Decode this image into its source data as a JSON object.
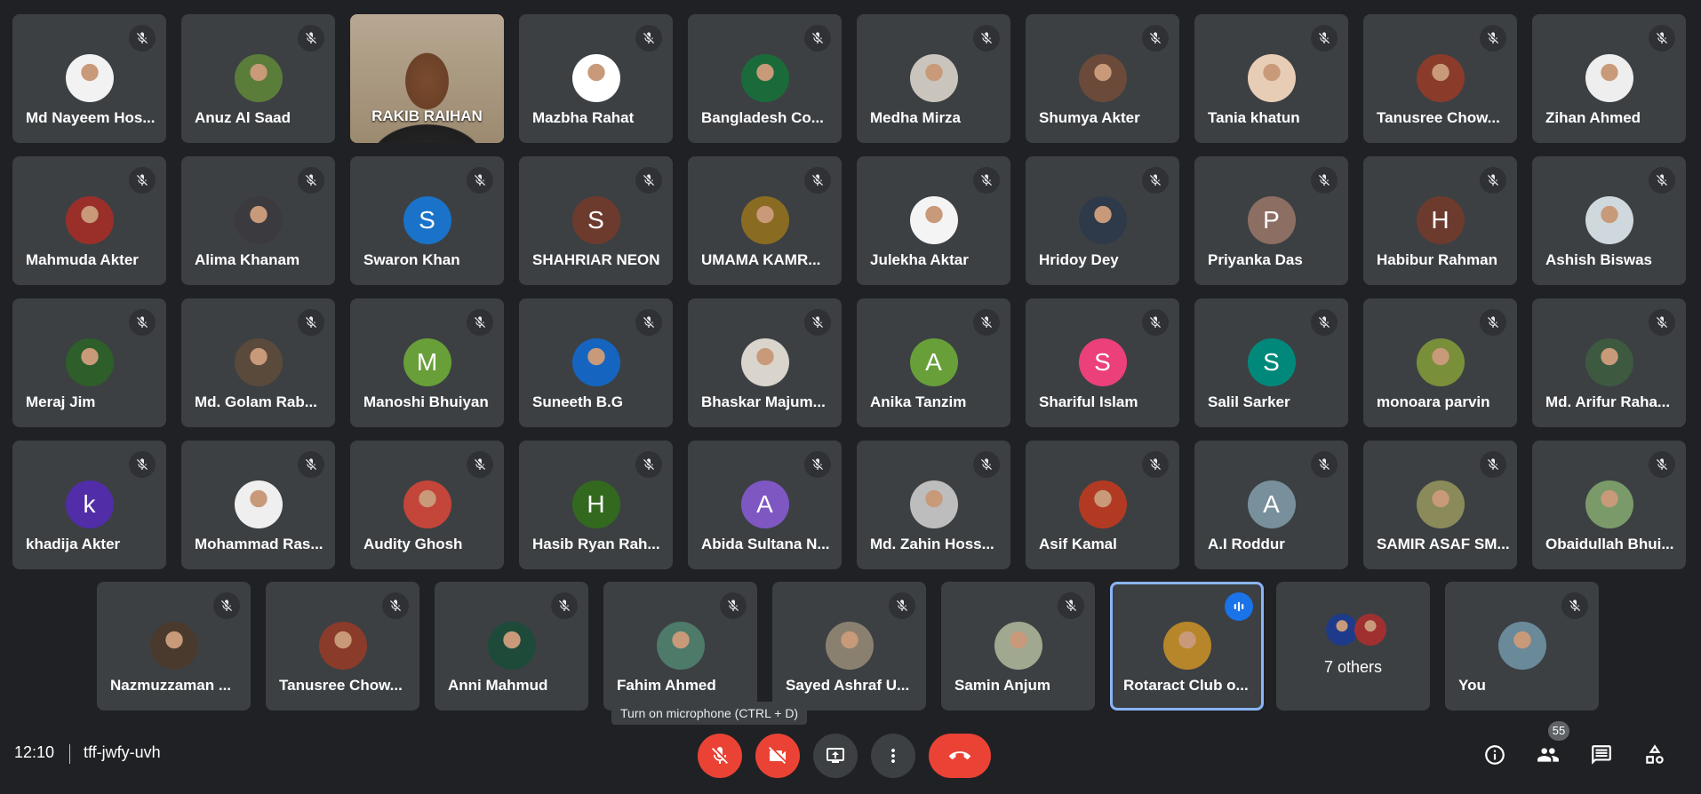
{
  "participants": [
    {
      "name": "Md Nayeem Hos...",
      "avatar": "photo",
      "color": "#f2f2f2"
    },
    {
      "name": "Anuz Al Saad",
      "avatar": "photo",
      "color": "#5b7d3a"
    },
    {
      "name": "RAKIB RAIHAN",
      "avatar": "video",
      "color": "#8a7358"
    },
    {
      "name": "Mazbha Rahat",
      "avatar": "photo",
      "color": "#ffffff"
    },
    {
      "name": "Bangladesh Co...",
      "avatar": "photo",
      "color": "#1b6b3a"
    },
    {
      "name": "Medha Mirza",
      "avatar": "photo",
      "color": "#c9c4bc"
    },
    {
      "name": "Shumya Akter",
      "avatar": "photo",
      "color": "#6b4a3a"
    },
    {
      "name": "Tania khatun",
      "avatar": "photo",
      "color": "#e8cdb6"
    },
    {
      "name": "Tanusree Chow...",
      "avatar": "photo",
      "color": "#8a3b2a"
    },
    {
      "name": "Zihan Ahmed",
      "avatar": "photo",
      "color": "#eeeeee"
    },
    {
      "name": "Mahmuda Akter",
      "avatar": "photo",
      "color": "#9a2f2a"
    },
    {
      "name": "Alima Khanam",
      "avatar": "photo",
      "color": "#3b3a3f"
    },
    {
      "name": "Swaron Khan",
      "avatar": "letter",
      "letter": "S",
      "color": "#1a73c8"
    },
    {
      "name": "SHAHRIAR NEON",
      "avatar": "letter",
      "letter": "S",
      "color": "#6d3b2e"
    },
    {
      "name": "UMAMA KAMR...",
      "avatar": "photo",
      "color": "#8a6b22"
    },
    {
      "name": "Julekha Aktar",
      "avatar": "photo",
      "color": "#f4f4f4"
    },
    {
      "name": "Hridoy Dey",
      "avatar": "photo",
      "color": "#2e3a4a"
    },
    {
      "name": "Priyanka Das",
      "avatar": "letter",
      "letter": "P",
      "color": "#8d6e63"
    },
    {
      "name": "Habibur Rahman",
      "avatar": "letter",
      "letter": "H",
      "color": "#6d3b2e"
    },
    {
      "name": "Ashish Biswas",
      "avatar": "photo",
      "color": "#cfd8dc"
    },
    {
      "name": "Meraj Jim",
      "avatar": "photo",
      "color": "#2e5e2a"
    },
    {
      "name": "Md. Golam Rab...",
      "avatar": "photo",
      "color": "#5a4a3c"
    },
    {
      "name": "Manoshi Bhuiyan",
      "avatar": "letter",
      "letter": "M",
      "color": "#689f38"
    },
    {
      "name": "Suneeth B.G",
      "avatar": "photo",
      "color": "#1565c0"
    },
    {
      "name": "Bhaskar Majum...",
      "avatar": "photo",
      "color": "#d9d4cc"
    },
    {
      "name": "Anika Tanzim",
      "avatar": "letter",
      "letter": "A",
      "color": "#689f38"
    },
    {
      "name": "Shariful Islam",
      "avatar": "letter",
      "letter": "S",
      "color": "#ec407a"
    },
    {
      "name": "Salil Sarker",
      "avatar": "letter",
      "letter": "S",
      "color": "#00897b"
    },
    {
      "name": "monoara parvin",
      "avatar": "photo",
      "color": "#7a8f3a"
    },
    {
      "name": "Md. Arifur Raha...",
      "avatar": "photo",
      "color": "#3d5a40"
    },
    {
      "name": "khadija Akter",
      "avatar": "letter",
      "letter": "k",
      "color": "#512da8"
    },
    {
      "name": "Mohammad Ras...",
      "avatar": "photo",
      "color": "#efefef"
    },
    {
      "name": "Audity Ghosh",
      "avatar": "photo",
      "color": "#c4453a"
    },
    {
      "name": "Hasib Ryan Rah...",
      "avatar": "letter",
      "letter": "H",
      "color": "#33691e"
    },
    {
      "name": "Abida Sultana N...",
      "avatar": "letter",
      "letter": "A",
      "color": "#7e57c2"
    },
    {
      "name": "Md. Zahin Hoss...",
      "avatar": "photo",
      "color": "#bdbdbd"
    },
    {
      "name": "Asif Kamal",
      "avatar": "photo",
      "color": "#b23a22"
    },
    {
      "name": "A.I Roddur",
      "avatar": "letter",
      "letter": "A",
      "color": "#78909c"
    },
    {
      "name": "SAMIR ASAF SM...",
      "avatar": "photo",
      "color": "#8a8a5a"
    },
    {
      "name": "Obaidullah Bhui...",
      "avatar": "photo",
      "color": "#7a9a6a"
    },
    {
      "name": "Nazmuzzaman ...",
      "avatar": "photo",
      "color": "#4a3a2e"
    },
    {
      "name": "Tanusree Chow...",
      "avatar": "photo",
      "color": "#8a3b2a"
    },
    {
      "name": "Anni Mahmud",
      "avatar": "photo",
      "color": "#1e4a3a"
    },
    {
      "name": "Fahim Ahmed",
      "avatar": "photo",
      "color": "#4e7a6a"
    },
    {
      "name": "Sayed Ashraf U...",
      "avatar": "photo",
      "color": "#8a8070"
    },
    {
      "name": "Samin Anjum",
      "avatar": "photo",
      "color": "#a0a890"
    },
    {
      "name": "Rotaract Club o...",
      "avatar": "photo",
      "color": "#b8862a",
      "speaking": true
    }
  ],
  "others": {
    "label": "7 others",
    "colors": [
      "#1e3a8a",
      "#a03030"
    ]
  },
  "you": {
    "name": "You",
    "color": "#6a8a9a"
  },
  "tooltip": "Turn on microphone (CTRL + D)",
  "bottom": {
    "time": "12:10",
    "meeting_code": "tff-jwfy-uvh",
    "people_count": "55"
  },
  "colors": {
    "background": "#202124",
    "tile": "#3c4043",
    "danger": "#ea4335",
    "speaking": "#8ab4f8"
  }
}
